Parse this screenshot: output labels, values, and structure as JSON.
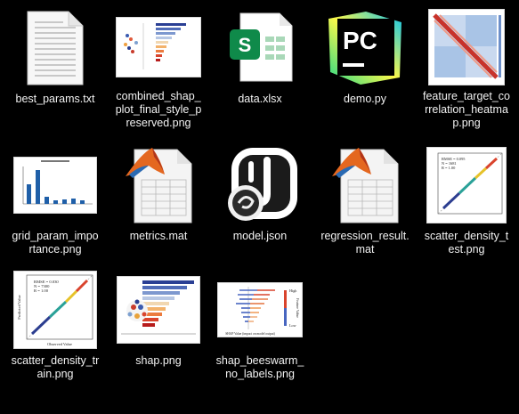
{
  "files": [
    {
      "name": "best_params.txt",
      "icon": "text-file-icon"
    },
    {
      "name": "combined_shap_plot_final_style_preserved.png",
      "icon": "image-thumbnail"
    },
    {
      "name": "data.xlsx",
      "icon": "excel-file-icon"
    },
    {
      "name": "demo.py",
      "icon": "pycharm-icon"
    },
    {
      "name": "feature_target_correlation_heatmap.png",
      "icon": "image-thumbnail"
    },
    {
      "name": "grid_param_importance.png",
      "icon": "image-thumbnail"
    },
    {
      "name": "metrics.mat",
      "icon": "matlab-file-icon"
    },
    {
      "name": "model.json",
      "icon": "json-file-icon"
    },
    {
      "name": "regression_result.mat",
      "icon": "matlab-file-icon"
    },
    {
      "name": "scatter_density_test.png",
      "icon": "image-thumbnail"
    },
    {
      "name": "scatter_density_train.png",
      "icon": "image-thumbnail"
    },
    {
      "name": "shap.png",
      "icon": "image-thumbnail"
    },
    {
      "name": "shap_beeswarm_no_labels.png",
      "icon": "image-thumbnail"
    }
  ],
  "thumbnail_text": {
    "pycharm_letters": "PC",
    "excel_letter": "S",
    "test_stats": [
      "RMSE = 0.095",
      "N = 1681",
      "R = 1.00"
    ],
    "train_stats": [
      "RMSE = 0.030",
      "N = 7300",
      "R = 1.00"
    ],
    "train_xlabel": "Observed Value",
    "train_ylabel": "Predicted Value",
    "beeswarm_high": "High",
    "beeswarm_low": "Low",
    "beeswarm_feature": "Feature Value",
    "beeswarm_xlabel": "SHAP Value (impact on model output)"
  }
}
